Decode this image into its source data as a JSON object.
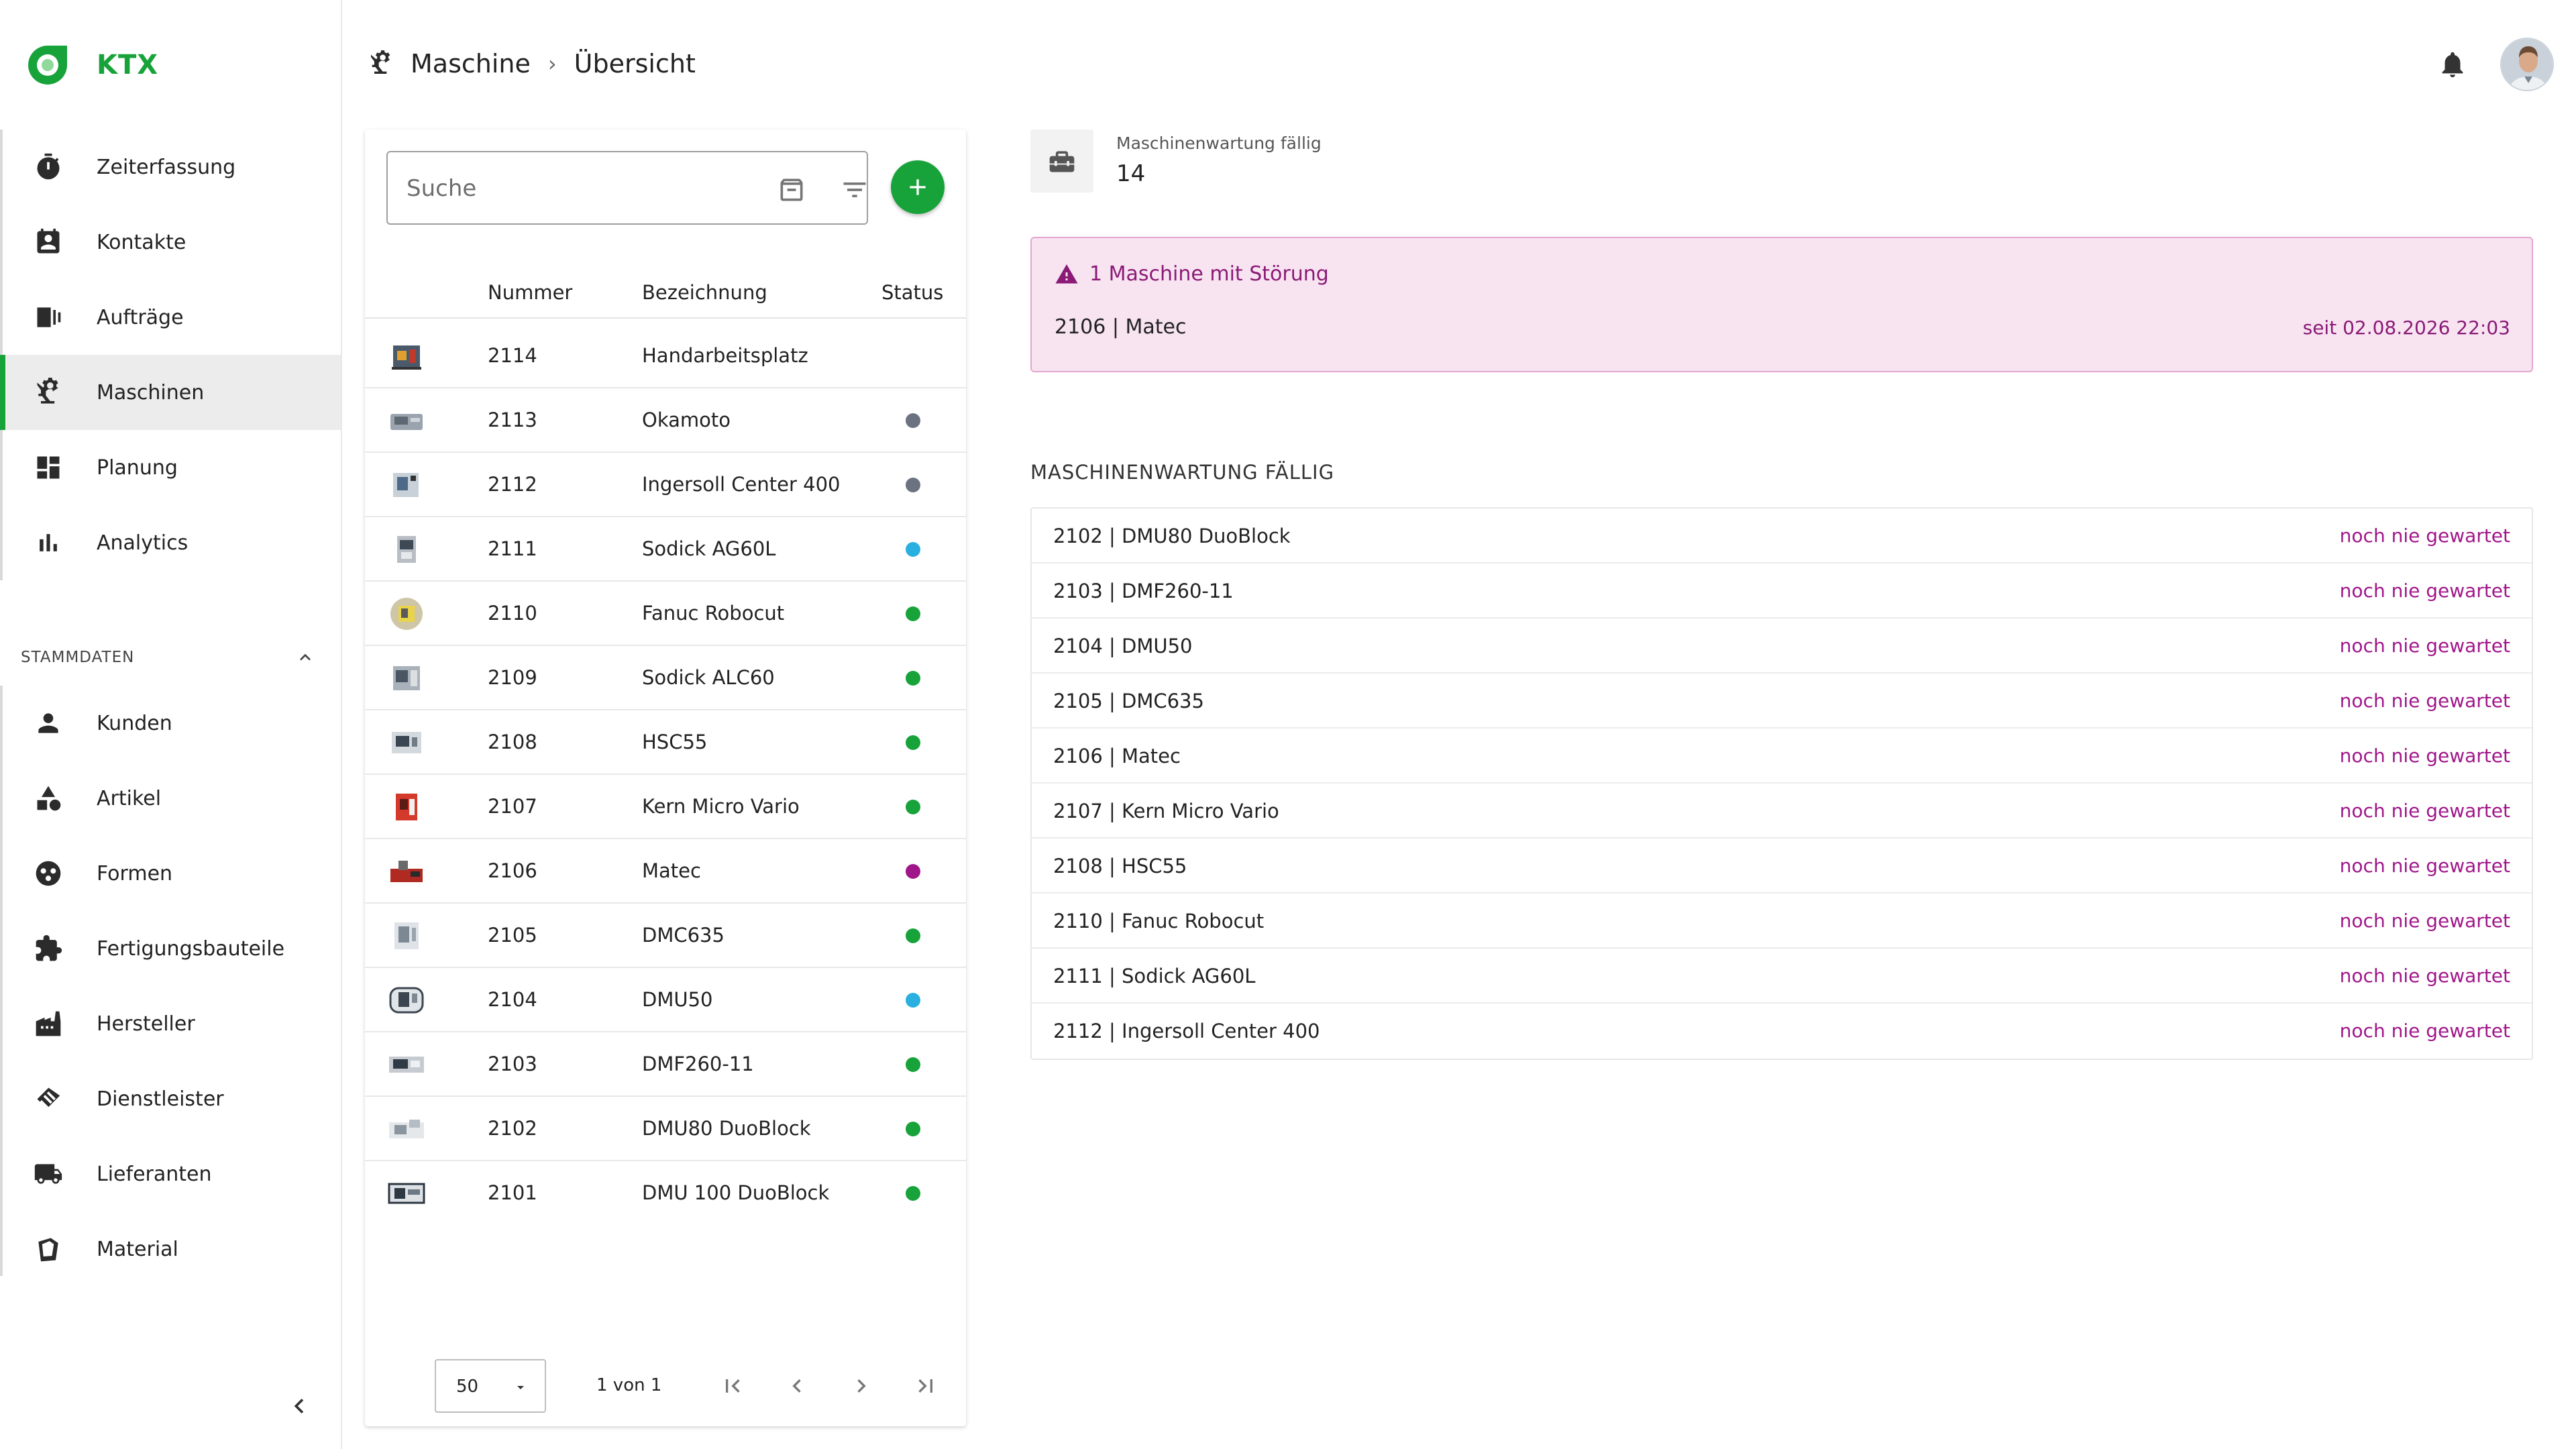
{
  "brand": {
    "name": "KTX",
    "color": "#18a33a"
  },
  "nav": {
    "top": [
      {
        "label": "Zeiterfassung",
        "icon": "stopwatch-icon"
      },
      {
        "label": "Kontakte",
        "icon": "contact-card-icon"
      },
      {
        "label": "Aufträge",
        "icon": "orders-icon"
      },
      {
        "label": "Maschinen",
        "icon": "machine-arm-icon",
        "active": true
      },
      {
        "label": "Planung",
        "icon": "dashboard-icon"
      },
      {
        "label": "Analytics",
        "icon": "bar-chart-icon"
      }
    ],
    "section_title": "STAMMDATEN",
    "bottom": [
      {
        "label": "Kunden",
        "icon": "person-icon"
      },
      {
        "label": "Artikel",
        "icon": "shapes-icon"
      },
      {
        "label": "Formen",
        "icon": "molds-icon"
      },
      {
        "label": "Fertigungsbauteile",
        "icon": "puzzle-icon"
      },
      {
        "label": "Hersteller",
        "icon": "factory-icon"
      },
      {
        "label": "Dienstleister",
        "icon": "handshake-icon"
      },
      {
        "label": "Lieferanten",
        "icon": "truck-icon"
      },
      {
        "label": "Material",
        "icon": "material-icon"
      }
    ]
  },
  "breadcrumb": {
    "parent": "Maschine",
    "current": "Übersicht"
  },
  "search": {
    "placeholder": "Suche"
  },
  "table": {
    "headers": {
      "number": "Nummer",
      "name": "Bezeichnung",
      "status": "Status"
    },
    "rows": [
      {
        "number": "2114",
        "name": "Handarbeitsplatz",
        "status": ""
      },
      {
        "number": "2113",
        "name": "Okamoto",
        "status": "#6b7280"
      },
      {
        "number": "2112",
        "name": "Ingersoll Center 400",
        "status": "#6b7280"
      },
      {
        "number": "2111",
        "name": "Sodick AG60L",
        "status": "#29b0e0"
      },
      {
        "number": "2110",
        "name": "Fanuc Robocut",
        "status": "#18a33a"
      },
      {
        "number": "2109",
        "name": "Sodick ALC60",
        "status": "#18a33a"
      },
      {
        "number": "2108",
        "name": "HSC55",
        "status": "#18a33a"
      },
      {
        "number": "2107",
        "name": "Kern Micro Vario",
        "status": "#18a33a"
      },
      {
        "number": "2106",
        "name": "Matec",
        "status": "#a0168a"
      },
      {
        "number": "2105",
        "name": "DMC635",
        "status": "#18a33a"
      },
      {
        "number": "2104",
        "name": "DMU50",
        "status": "#29b0e0"
      },
      {
        "number": "2103",
        "name": "DMF260-11",
        "status": "#18a33a"
      },
      {
        "number": "2102",
        "name": "DMU80 DuoBlock",
        "status": "#18a33a"
      },
      {
        "number": "2101",
        "name": "DMU 100 DuoBlock",
        "status": "#18a33a"
      }
    ]
  },
  "pager": {
    "page_size": "50",
    "info": "1 von 1"
  },
  "kpi": {
    "label": "Maschinenwartung fällig",
    "value": "14"
  },
  "alert": {
    "title": "1 Maschine mit Störung",
    "item": "2106 | Matec",
    "since": "seit 02.08.2026 22:03"
  },
  "maintenance": {
    "title": "MASCHINENWARTUNG FÄLLIG",
    "items": [
      {
        "name": "2102 | DMU80 DuoBlock",
        "status": "noch nie gewartet"
      },
      {
        "name": "2103 | DMF260-11",
        "status": "noch nie gewartet"
      },
      {
        "name": "2104 | DMU50",
        "status": "noch nie gewartet"
      },
      {
        "name": "2105 | DMC635",
        "status": "noch nie gewartet"
      },
      {
        "name": "2106 | Matec",
        "status": "noch nie gewartet"
      },
      {
        "name": "2107 | Kern Micro Vario",
        "status": "noch nie gewartet"
      },
      {
        "name": "2108 | HSC55",
        "status": "noch nie gewartet"
      },
      {
        "name": "2110 | Fanuc Robocut",
        "status": "noch nie gewartet"
      },
      {
        "name": "2111 | Sodick AG60L",
        "status": "noch nie gewartet"
      },
      {
        "name": "2112 | Ingersoll Center 400",
        "status": "noch nie gewartet"
      }
    ]
  }
}
